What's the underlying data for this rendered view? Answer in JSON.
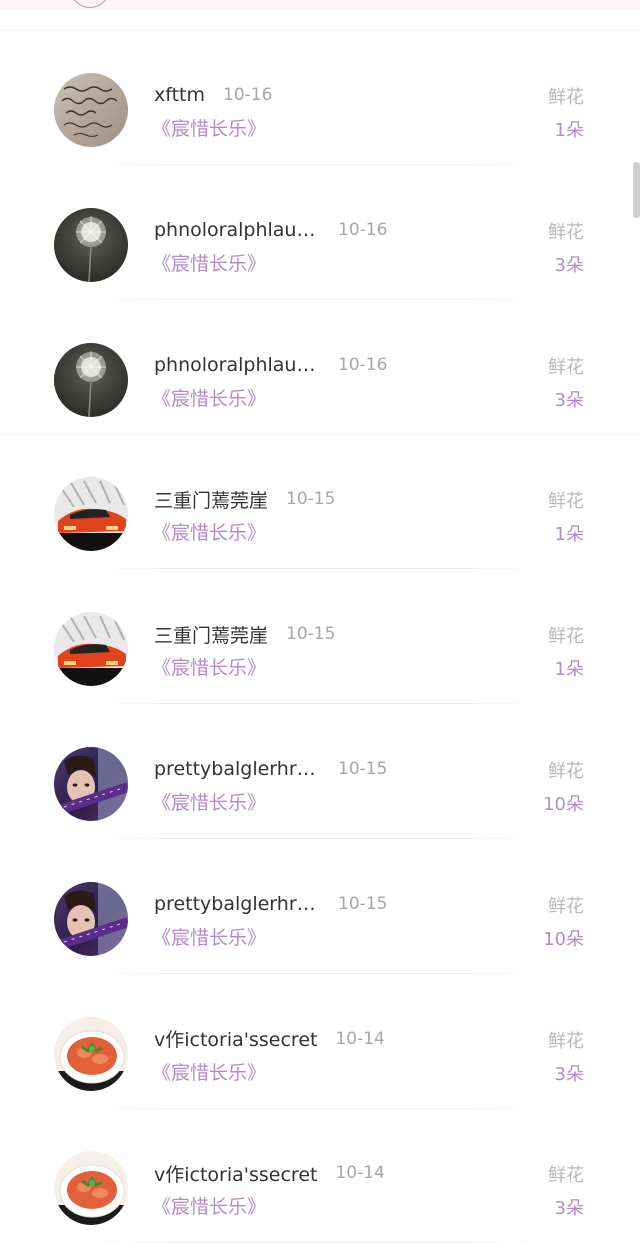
{
  "records": [
    {
      "name": "xfttm",
      "date": "10-16",
      "book": "《宸惜长乐》",
      "gift": "鲜花",
      "count": "1朵",
      "avatar": "handwriting-avatar"
    },
    {
      "name": "phnoloralphlaurnen",
      "date": "10-16",
      "book": "《宸惜长乐》",
      "gift": "鲜花",
      "count": "3朵",
      "avatar": "dandelion-avatar"
    },
    {
      "name": "phnoloralphlaurnen",
      "date": "10-16",
      "book": "《宸惜长乐》",
      "gift": "鲜花",
      "count": "3朵",
      "avatar": "dandelion-avatar"
    },
    {
      "name": "三重门蔫莞崖",
      "date": "10-15",
      "book": "《宸惜长乐》",
      "gift": "鲜花",
      "count": "1朵",
      "avatar": "red-car-avatar"
    },
    {
      "name": "三重门蔫莞崖",
      "date": "10-15",
      "book": "《宸惜长乐》",
      "gift": "鲜花",
      "count": "1朵",
      "avatar": "red-car-avatar"
    },
    {
      "name": "prettybalglerhrin...",
      "date": "10-15",
      "book": "《宸惜长乐》",
      "gift": "鲜花",
      "count": "10朵",
      "avatar": "portrait-avatar"
    },
    {
      "name": "prettybalglerhrin...",
      "date": "10-15",
      "book": "《宸惜长乐》",
      "gift": "鲜花",
      "count": "10朵",
      "avatar": "portrait-avatar"
    },
    {
      "name": "v作ictoria'ssecret",
      "date": "10-14",
      "book": "《宸惜长乐》",
      "gift": "鲜花",
      "count": "3朵",
      "avatar": "food-plate-avatar"
    },
    {
      "name": "v作ictoria'ssecret",
      "date": "10-14",
      "book": "《宸惜长乐》",
      "gift": "鲜花",
      "count": "3朵",
      "avatar": "food-plate-avatar"
    }
  ],
  "colors": {
    "accent": "#b48bcd",
    "name": "#333333",
    "muted": "#a7a7a7",
    "divider": "#efefef"
  }
}
